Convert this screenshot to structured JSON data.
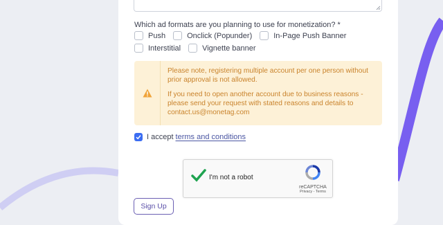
{
  "colors": {
    "accent": "#3b6df2",
    "link": "#4a55a2",
    "notice_bg": "#fdf1d7",
    "notice_text": "#c9832c",
    "signup": "#6b5fb3"
  },
  "form": {
    "ad_formats_question": "Which ad formats are you planning to use for monetization? *",
    "ad_formats": [
      {
        "label": "Push",
        "checked": false
      },
      {
        "label": "Onclick (Popunder)",
        "checked": false
      },
      {
        "label": "In-Page Push Banner",
        "checked": false
      },
      {
        "label": "Interstitial",
        "checked": false
      },
      {
        "label": "Vignette banner",
        "checked": false
      }
    ],
    "notice": {
      "icon": "warning-icon",
      "line1": "Please note, registering multiple account per one person without prior approval is not allowed.",
      "line2": "If you need to open another account due to business reasons - please send your request with stated reasons and details to contact.us@monetag.com"
    },
    "accept": {
      "checked": true,
      "label": "I accept",
      "link": "terms and conditions"
    },
    "captcha": {
      "label": "I'm not a robot",
      "checked": true,
      "brand": "reCAPTCHA",
      "privacy": "Privacy",
      "separator": "-",
      "terms": "Terms"
    },
    "submit_label": "Sign Up"
  }
}
